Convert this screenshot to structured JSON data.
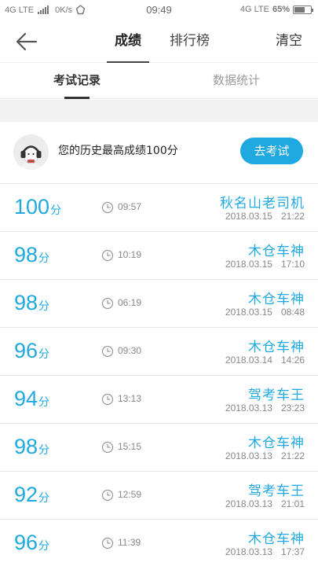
{
  "status_bar": {
    "left_network": "4G LTE",
    "speed": "0K/s",
    "time": "09:49",
    "right_network": "4G LTE",
    "battery_text": "65%",
    "battery_level": 0.65
  },
  "header": {
    "tabs": [
      {
        "label": "成绩",
        "active": true
      },
      {
        "label": "排行榜",
        "active": false
      }
    ],
    "clear_label": "清空"
  },
  "subtabs": [
    {
      "label": "考试记录",
      "active": true
    },
    {
      "label": "数据统计",
      "active": false
    }
  ],
  "best": {
    "text": "您的历史最高成绩100分",
    "button_label": "去考试"
  },
  "records": [
    {
      "score": "100",
      "unit": "分",
      "duration": "09:57",
      "player": "秋名山老司机",
      "date": "2018.03.15",
      "clock": "21:22"
    },
    {
      "score": "98",
      "unit": "分",
      "duration": "10:19",
      "player": "木仓车神",
      "date": "2018.03.15",
      "clock": "17:10"
    },
    {
      "score": "98",
      "unit": "分",
      "duration": "06:19",
      "player": "木仓车神",
      "date": "2018.03.15",
      "clock": "08:48"
    },
    {
      "score": "96",
      "unit": "分",
      "duration": "09:30",
      "player": "木仓车神",
      "date": "2018.03.14",
      "clock": "14:26"
    },
    {
      "score": "94",
      "unit": "分",
      "duration": "13:13",
      "player": "驾考车王",
      "date": "2018.03.13",
      "clock": "23:23"
    },
    {
      "score": "98",
      "unit": "分",
      "duration": "15:15",
      "player": "木仓车神",
      "date": "2018.03.13",
      "clock": "21:22"
    },
    {
      "score": "92",
      "unit": "分",
      "duration": "12:59",
      "player": "驾考车王",
      "date": "2018.03.13",
      "clock": "21:01"
    },
    {
      "score": "96",
      "unit": "分",
      "duration": "11:39",
      "player": "木仓车神",
      "date": "2018.03.13",
      "clock": "17:37"
    }
  ],
  "colors": {
    "accent": "#1fa9e0",
    "text": "#333333",
    "muted": "#888888"
  },
  "icons": {
    "back": "arrow-left-icon",
    "clock": "clock-icon",
    "avatar": "avatar-headphones-icon"
  }
}
